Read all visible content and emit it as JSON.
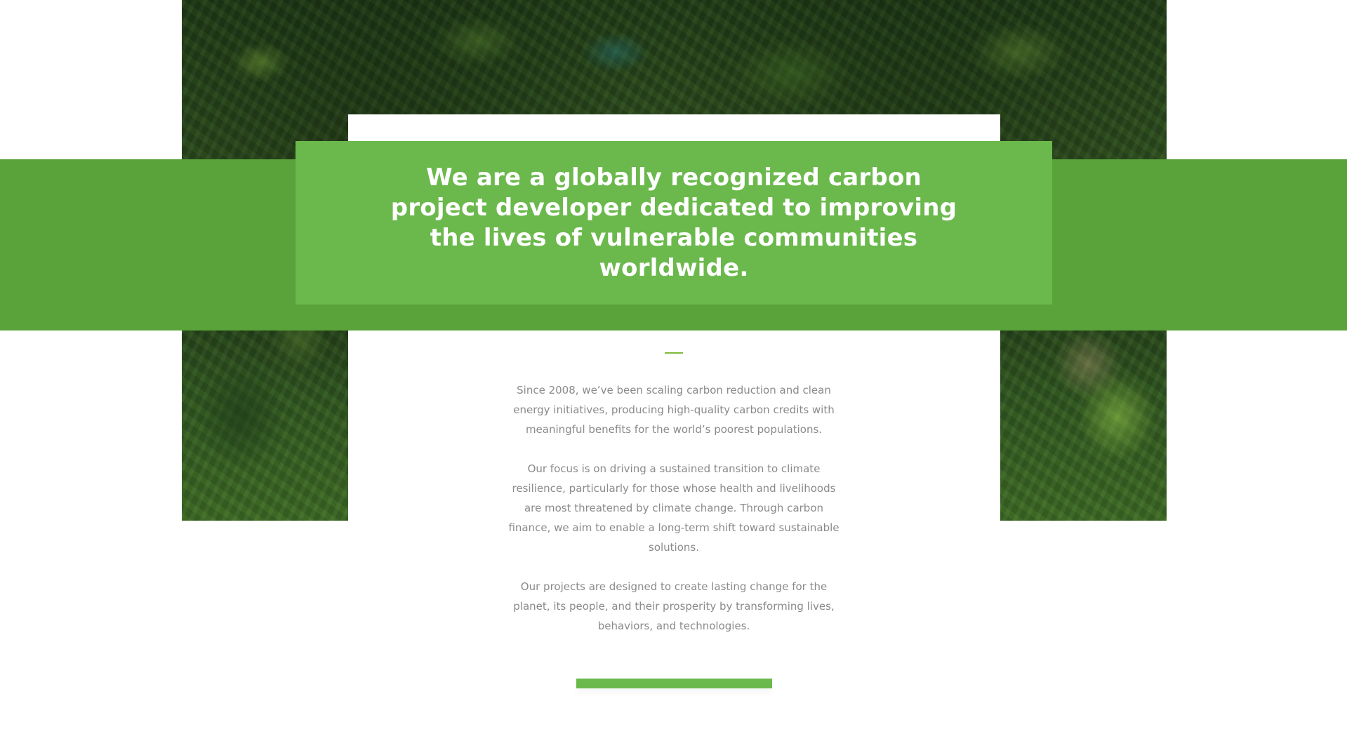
{
  "headline": {
    "text": "We are a globally recognized carbon project developer dedicated to improving the lives of vulnerable communities worldwide."
  },
  "body": {
    "paragraphs": [
      "Since 2008, we’ve been scaling carbon reduction and clean energy initiatives, producing high-quality carbon credits with meaningful benefits for the world’s poorest populations.",
      "Our focus is on driving a sustained transition to climate resilience, particularly for those whose health and livelihoods are most threatened by climate change. Through carbon finance, we aim to enable a long-term shift toward sustainable solutions.",
      "Our projects are designed to create lasting change for the planet, its people, and their prosperity by transforming lives, behaviors, and technologies."
    ]
  },
  "colors": {
    "band_dark_green": "#5aa23a",
    "headline_green": "#6bb94c",
    "divider_green": "#7dbb3a",
    "body_text_gray": "#8a8a8a"
  }
}
